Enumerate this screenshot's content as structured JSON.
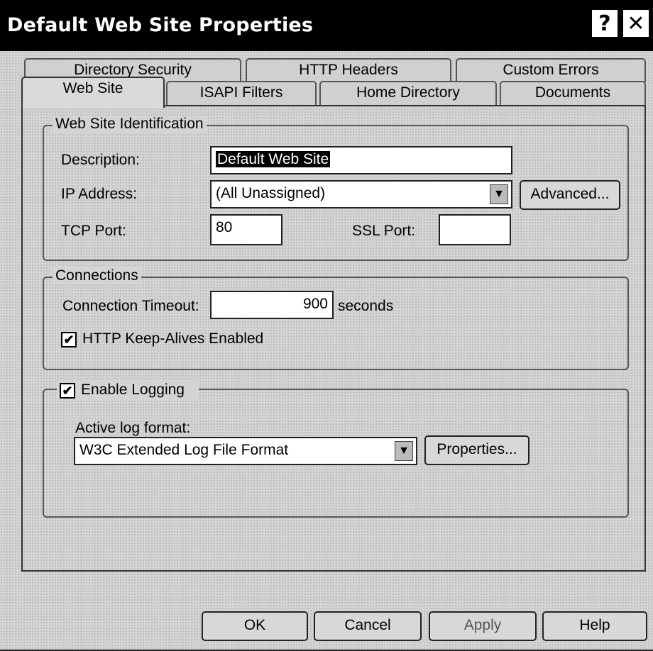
{
  "window": {
    "title": "Default Web Site Properties",
    "help_glyph": "?",
    "close_glyph": "✕"
  },
  "tabs_back": [
    "Directory Security",
    "HTTP Headers",
    "Custom Errors"
  ],
  "tabs_front": [
    "Web Site",
    "ISAPI Filters",
    "Home Directory",
    "Documents"
  ],
  "identification": {
    "legend": "Web Site Identification",
    "description_label": "Description:",
    "description_value": "Default Web Site",
    "ip_label": "IP Address:",
    "ip_value": "(All Unassigned)",
    "advanced_label": "Advanced...",
    "tcp_label": "TCP Port:",
    "tcp_value": "80",
    "ssl_label": "SSL Port:",
    "ssl_value": ""
  },
  "connections": {
    "legend": "Connections",
    "timeout_label": "Connection Timeout:",
    "timeout_value": "900",
    "timeout_unit": "seconds",
    "keepalive_label": "HTTP Keep-Alives Enabled",
    "keepalive_checked": true
  },
  "logging": {
    "enable_label": "Enable Logging",
    "enable_checked": true,
    "format_label": "Active log format:",
    "format_value": "W3C Extended Log File Format",
    "properties_label": "Properties..."
  },
  "buttons": {
    "ok": "OK",
    "cancel": "Cancel",
    "apply": "Apply",
    "help": "Help"
  },
  "icons": {
    "dropdown": "chevron-down-icon",
    "check": "✔"
  }
}
